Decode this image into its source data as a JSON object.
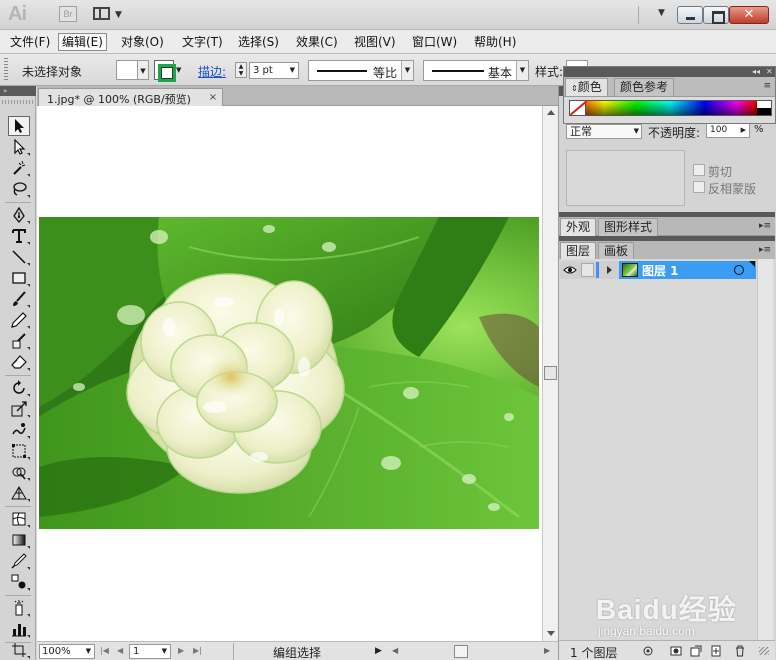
{
  "titlebar": {
    "app_logo": "Ai",
    "bridge_label": "Br",
    "close_glyph": "✕"
  },
  "menu": [
    "文件(F)",
    "编辑(E)",
    "对象(O)",
    "文字(T)",
    "选择(S)",
    "效果(C)",
    "视图(V)",
    "窗口(W)",
    "帮助(H)"
  ],
  "active_menu": "编辑(E)",
  "control_bar": {
    "selection_status": "未选择对象",
    "stroke_link": "描边:",
    "stroke_weight": "3 pt",
    "profile_label": "等比",
    "brush_label": "基本",
    "style_label": "样式:",
    "stroke_color": "#1aa64a"
  },
  "tools": {
    "panel_label": "»",
    "items": [
      "selection-tool",
      "direct-selection-tool",
      "magic-wand-tool",
      "lasso-tool",
      "pen-tool",
      "type-tool",
      "line-segment-tool",
      "rectangle-tool",
      "paintbrush-tool",
      "pencil-tool",
      "blob-brush-tool",
      "eraser-tool",
      "rotate-tool",
      "scale-tool",
      "warp-tool",
      "free-transform-tool",
      "shape-builder-tool",
      "perspective-grid-tool",
      "mesh-tool",
      "gradient-tool",
      "eyedropper-tool",
      "blend-tool",
      "symbol-sprayer-tool",
      "column-graph-tool",
      "artboard-tool"
    ]
  },
  "document": {
    "tab_title": "1.jpg* @ 100% (RGB/预览)",
    "tab_close": "×",
    "artwork": "jasmine flower photo",
    "zoom": "100%",
    "page": "1",
    "status": "编组选择"
  },
  "color_panel": {
    "tabs": [
      "颜色",
      "颜色参考"
    ],
    "active_tab": "颜色"
  },
  "transparency_panel": {
    "blend_mode": "正常",
    "opacity_label": "不透明度:",
    "opacity_value": "100",
    "opacity_unit": "%",
    "clip_label": "剪切",
    "invert_mask_label": "反相蒙版"
  },
  "appearance_panel": {
    "tabs": [
      "外观",
      "图形样式"
    ]
  },
  "layers_panel": {
    "tabs": [
      "图层",
      "画板"
    ],
    "layers": [
      {
        "name": "图层 1",
        "visible": true,
        "selected": true,
        "color": "#4a8cff"
      }
    ],
    "count": "1 个图层"
  },
  "watermark": {
    "brand": "Baidu经验",
    "domain": "jingyan.baidu.com"
  }
}
